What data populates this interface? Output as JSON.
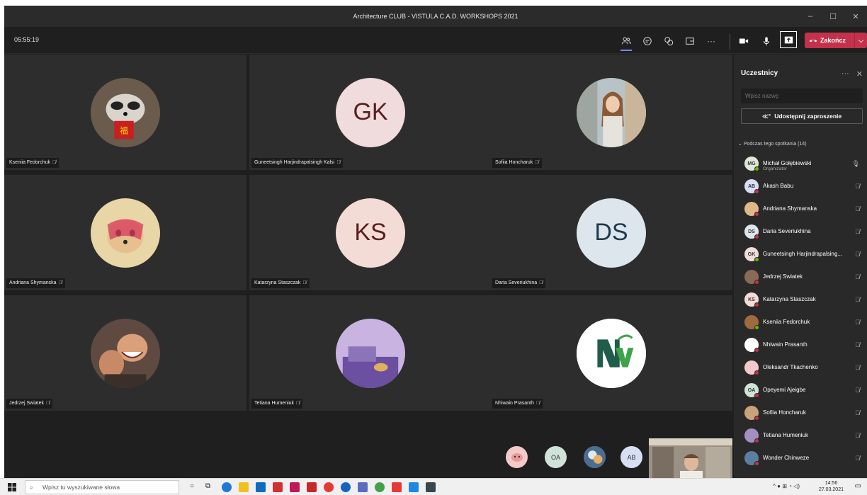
{
  "window": {
    "title": "Architecture CLUB - VISTULA C.A.D. WORKSHOPS 2021",
    "controls": [
      "–",
      "☐",
      "✕"
    ]
  },
  "meeting": {
    "timer": "05:55:19",
    "leave_label": "Zakończ",
    "tiles": [
      {
        "name": "Kseniia Fedorchuk",
        "initials": "",
        "avatar": "photo-raccoon"
      },
      {
        "name": "Guneetsingh Harjindrapalsingh Kalsi",
        "initials": "GK",
        "avatar": "initials",
        "color": "#f0dcdc"
      },
      {
        "name": "Sofiia Honcharuk",
        "initials": "",
        "avatar": "photo-woman"
      },
      {
        "name": "Andriana Shymanska",
        "initials": "",
        "avatar": "photo-dog"
      },
      {
        "name": "Katarzyna Staszczak",
        "initials": "KS",
        "avatar": "initials",
        "color": "#f4dcd6"
      },
      {
        "name": "Daria Severiukhina",
        "initials": "DS",
        "avatar": "initials",
        "color": "#dde6ec"
      },
      {
        "name": "Jedrzej Swiatek",
        "initials": "",
        "avatar": "photo-laughing"
      },
      {
        "name": "Tetiana Humeniuk",
        "initials": "",
        "avatar": "photo-illustration"
      },
      {
        "name": "Nhiwain Prasanth",
        "initials": "",
        "avatar": "logo-nvn"
      }
    ],
    "overflow_avatars": [
      {
        "initials": "",
        "color": "#f4c9c9"
      },
      {
        "initials": "OA",
        "color": "#cfe3d8"
      },
      {
        "initials": "",
        "color": "#5a7fa0"
      },
      {
        "initials": "AB",
        "color": "#d7dff5"
      }
    ]
  },
  "panel": {
    "title": "Uczestnicy",
    "search_placeholder": "Wpisz nazwę",
    "invite_label": "Udostępnij zaproszenie",
    "section_label": "Podczas tego spotkania (14)",
    "participants": [
      {
        "name": "Michał Gołębiewski",
        "role": "Organizator",
        "initials": "MG",
        "color": "#dfe8d8",
        "status": "#6bb700",
        "mic": "on"
      },
      {
        "name": "Akash Babu",
        "role": "",
        "initials": "AB",
        "color": "#d7dff5",
        "status": "#c4314b",
        "mic": "off"
      },
      {
        "name": "Andriana Shymanska",
        "role": "",
        "initials": "",
        "color": "#e0b88a",
        "status": "#c4314b",
        "mic": "off"
      },
      {
        "name": "Daria Severiukhina",
        "role": "",
        "initials": "DS",
        "color": "#dde6ec",
        "status": "#c4314b",
        "mic": "off"
      },
      {
        "name": "Guneetsingh Harjindrapalsing...",
        "role": "",
        "initials": "GK",
        "color": "#f0dcdc",
        "status": "#6bb700",
        "mic": "off"
      },
      {
        "name": "Jedrzej Swiatek",
        "role": "",
        "initials": "",
        "color": "#8a6a55",
        "status": "#c4314b",
        "mic": "off"
      },
      {
        "name": "Katarzyna Staszczak",
        "role": "",
        "initials": "KS",
        "color": "#f4dcd6",
        "status": "#c4314b",
        "mic": "off"
      },
      {
        "name": "Kseniia Fedorchuk",
        "role": "",
        "initials": "",
        "color": "#a06a40",
        "status": "#6bb700",
        "mic": "off"
      },
      {
        "name": "Nhiwain Prasanth",
        "role": "",
        "initials": "",
        "color": "#ffffff",
        "status": "#c4314b",
        "mic": "off"
      },
      {
        "name": "Oleksandr Tkachenko",
        "role": "",
        "initials": "",
        "color": "#f4c9c9",
        "status": "#c4314b",
        "mic": "off"
      },
      {
        "name": "Opeyemi Ajeigbe",
        "role": "",
        "initials": "OA",
        "color": "#cfe3d8",
        "status": "#c4314b",
        "mic": "off"
      },
      {
        "name": "Sofiia Honcharuk",
        "role": "",
        "initials": "",
        "color": "#c9a37c",
        "status": "#c4314b",
        "mic": "off"
      },
      {
        "name": "Tetiana Humeniuk",
        "role": "",
        "initials": "",
        "color": "#a48fc0",
        "status": "#c4314b",
        "mic": "off"
      },
      {
        "name": "Wonder Chinweze",
        "role": "",
        "initials": "",
        "color": "#5a7fa0",
        "status": "#c4314b",
        "mic": "off"
      }
    ]
  },
  "taskbar": {
    "search_placeholder": "Wpisz tu wyszukiwane słowa",
    "time": "14:56",
    "date": "27.03.2021"
  },
  "colors": {
    "accent": "#7f85f5",
    "leave": "#c4314b",
    "tile": "#2d2d2d",
    "panel": "#292929"
  }
}
